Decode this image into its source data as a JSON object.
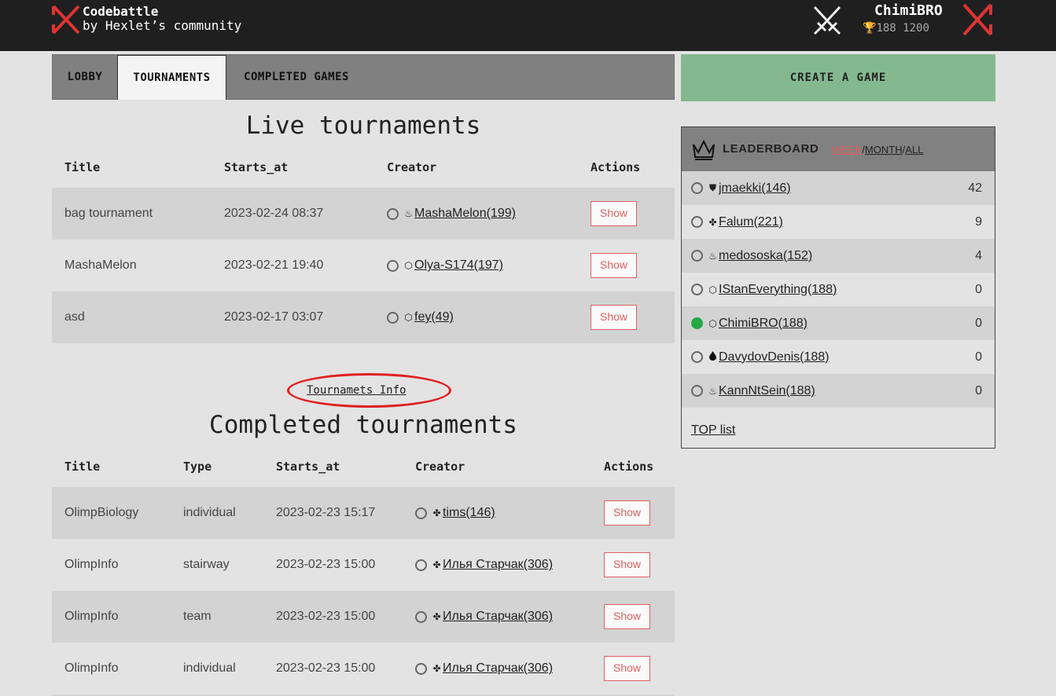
{
  "header": {
    "brand_name": "Codebattle",
    "brand_sub": "by Hexlet’s community",
    "user_name": "ChimiBRO",
    "user_stats": "188 1200"
  },
  "tabs": [
    {
      "label": "LOBBY"
    },
    {
      "label": "TOURNAMENTS"
    },
    {
      "label": "COMPLETED GAMES"
    }
  ],
  "create_game": "CREATE A GAME",
  "live": {
    "title": "Live tournaments",
    "headers": [
      "Title",
      "Starts_at",
      "Creator",
      "Actions"
    ],
    "rows": [
      {
        "title": "bag tournament",
        "starts_at": "2023-02-24 08:37",
        "creator": "MashaMelon(199)",
        "lang": "♨",
        "action": "Show"
      },
      {
        "title": "MashaMelon",
        "starts_at": "2023-02-21 19:40",
        "creator": "Olya-S174(197)",
        "lang": "⬡",
        "action": "Show"
      },
      {
        "title": "asd",
        "starts_at": "2023-02-17 03:07",
        "creator": "fey(49)",
        "lang": "⬡",
        "action": "Show"
      }
    ]
  },
  "info_link": "Tournamets Info",
  "completed": {
    "title": "Completed tournaments",
    "headers": [
      "Title",
      "Type",
      "Starts_at",
      "Creator",
      "Actions"
    ],
    "rows": [
      {
        "title": "OlimpBiology",
        "type": "individual",
        "starts_at": "2023-02-23 15:17",
        "creator": "tims(146)",
        "lang": "✤",
        "action": "Show"
      },
      {
        "title": "OlimpInfo",
        "type": "stairway",
        "starts_at": "2023-02-23 15:00",
        "creator": "Илья Старчак(306)",
        "lang": "✤",
        "action": "Show"
      },
      {
        "title": "OlimpInfo",
        "type": "team",
        "starts_at": "2023-02-23 15:00",
        "creator": "Илья Старчак(306)",
        "lang": "✤",
        "action": "Show"
      },
      {
        "title": "OlimpInfo",
        "type": "individual",
        "starts_at": "2023-02-23 15:00",
        "creator": "Илья Старчак(306)",
        "lang": "✤",
        "action": "Show"
      }
    ]
  },
  "leaderboard": {
    "title": "LEADERBOARD",
    "period_week": "WEEK",
    "period_month": "MONTH",
    "period_all": "ALL",
    "rows": [
      {
        "name": "jmaekki(146)",
        "score": "42",
        "lang": "⛊",
        "online": false
      },
      {
        "name": "Falum(221)",
        "score": "9",
        "lang": "✤",
        "online": false
      },
      {
        "name": "medososka(152)",
        "score": "4",
        "lang": "♨",
        "online": false
      },
      {
        "name": "IStanEverything(188)",
        "score": "0",
        "lang": "⬡",
        "online": false
      },
      {
        "name": "ChimiBRO(188)",
        "score": "0",
        "lang": "⬡",
        "online": true
      },
      {
        "name": "DavydovDenis(188)",
        "score": "0",
        "lang": "💧",
        "online": false
      },
      {
        "name": "KannNtSein(188)",
        "score": "0",
        "lang": "♨",
        "online": false
      }
    ],
    "top_list": "TOP list"
  },
  "colors": {
    "accent_green": "#84b990",
    "show_red": "#e06060",
    "highlight_circle": "#e02020",
    "online": "#28a745"
  }
}
